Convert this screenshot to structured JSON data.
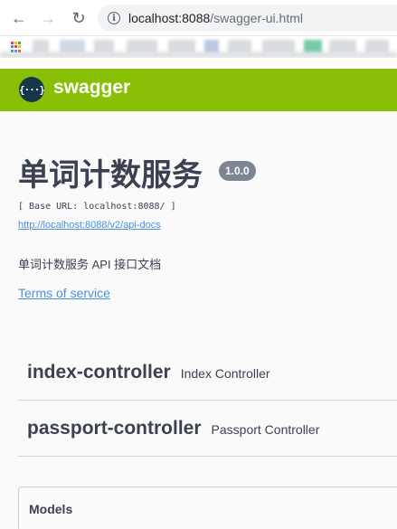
{
  "browser": {
    "url_host": "localhost:8088",
    "url_path": "/swagger-ui.html"
  },
  "icons": {
    "back": "arrow-left-icon",
    "forward": "arrow-right-icon",
    "reload": "reload-icon",
    "site_info": "info-icon",
    "apps": "apps-grid-icon",
    "swagger_logo": "swagger-logo-icon"
  },
  "colors": {
    "topbar": "#89bf04",
    "logo_bg": "#173647",
    "text": "#3b4151",
    "link": "#4990e2",
    "badge": "#7d8492"
  },
  "topbar": {
    "logo_glyph": "{···}",
    "brand": "swagger"
  },
  "info": {
    "title": "单词计数服务",
    "version": "1.0.0",
    "base_url": "[ Base URL: localhost:8088/ ]",
    "api_docs_url": "http://localhost:8088/v2/api-docs",
    "description": "单词计数服务 API 接口文档",
    "terms_link": "Terms of service"
  },
  "controllers": [
    {
      "name": "index-controller",
      "description": "Index Controller"
    },
    {
      "name": "passport-controller",
      "description": "Passport Controller"
    }
  ],
  "models": {
    "title": "Models"
  }
}
